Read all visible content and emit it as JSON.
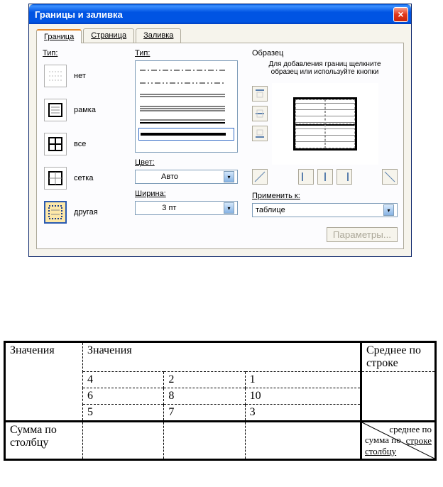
{
  "dialog": {
    "title": "Границы и заливка",
    "close": "×",
    "tabs": {
      "border": "Граница",
      "page": "Страница",
      "fill": "Заливка"
    },
    "type_label": "Тип:",
    "settings": {
      "none": "нет",
      "box": "рамка",
      "all": "все",
      "grid": "сетка",
      "custom": "другая"
    },
    "style_label": "Тип:",
    "color_label": "Цвет:",
    "color_value": "Авто",
    "width_label": "Ширина:",
    "width_value": "3 пт",
    "sample_label": "Образец",
    "hint": "Для добавления границ щелкните образец или используйте кнопки",
    "apply_label": "Применить к:",
    "apply_value": "таблице",
    "params_btn": "Параметры..."
  },
  "table": {
    "values_header": "Значения",
    "avg_header": "Среднее по строке",
    "row_label": "Значения",
    "sum_label": "Сумма по столбцу",
    "rows": [
      [
        "4",
        "2",
        "1"
      ],
      [
        "6",
        "8",
        "10"
      ],
      [
        "5",
        "7",
        "3"
      ]
    ],
    "diag_top1": "среднее по",
    "diag_top2": "строке",
    "diag_bot1": "сумма по",
    "diag_bot2": "столбцу"
  }
}
